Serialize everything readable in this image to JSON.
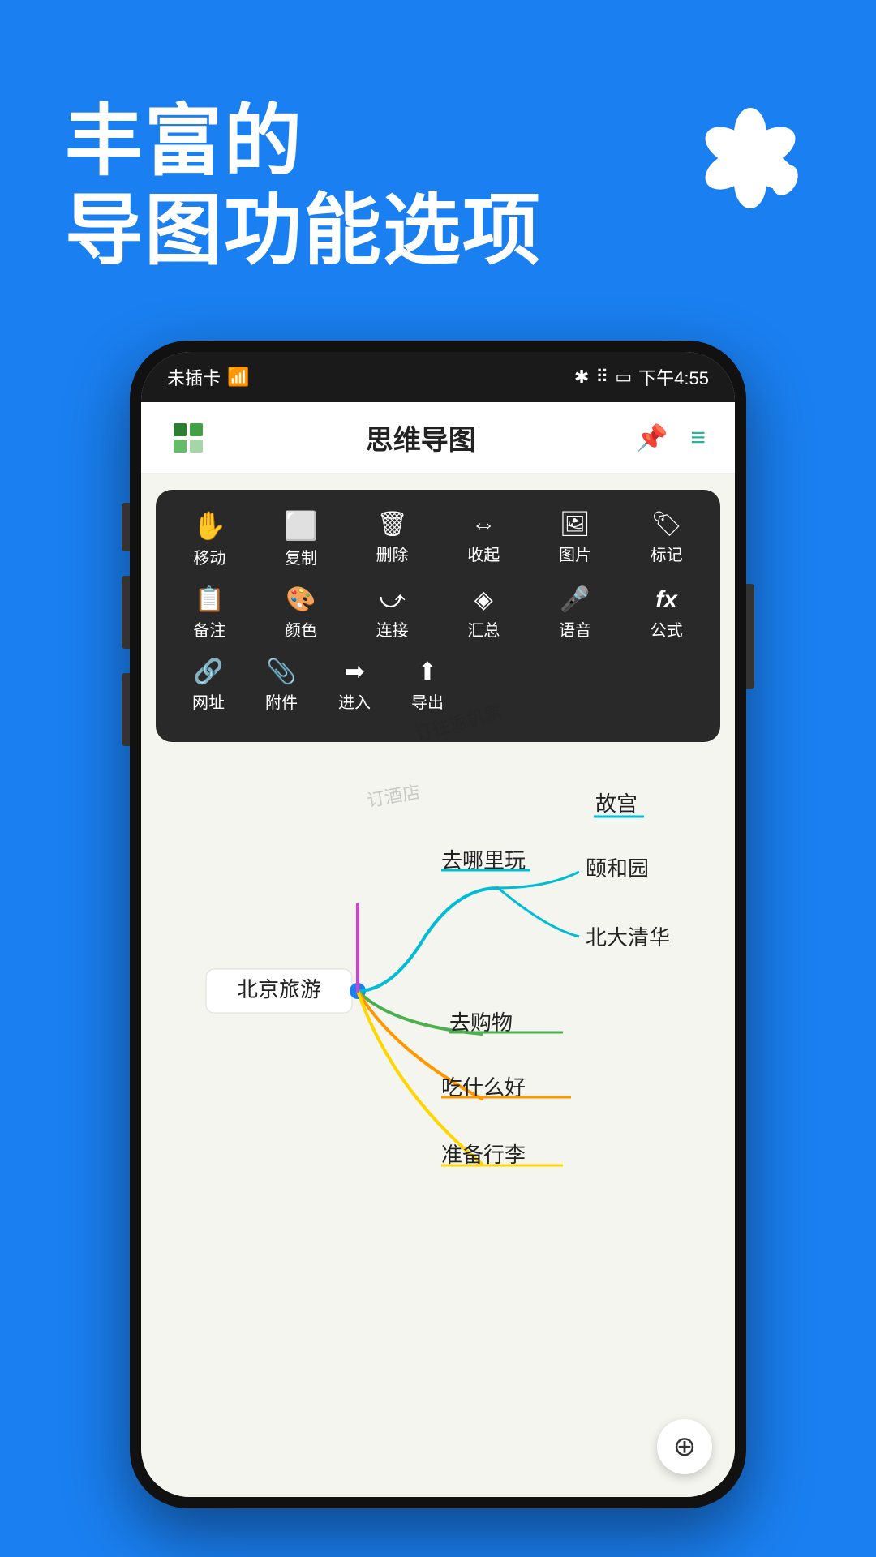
{
  "page": {
    "background_color": "#1a7ff0",
    "header_line1": "丰富的",
    "header_line2": "导图功能选项",
    "logo_alt": "flower-logo"
  },
  "status_bar": {
    "left": "未插卡🔋 📶",
    "left_text": "未插卡",
    "wifi": "WiFi",
    "bluetooth": "✱",
    "vibrate": "📳",
    "battery": "🔋",
    "time": "下午4:55"
  },
  "app_bar": {
    "title": "思维导图",
    "icon_left_alt": "layers-icon",
    "icon_right1_alt": "pin-icon",
    "icon_right2_alt": "menu-icon"
  },
  "toolbar": {
    "rows": [
      [
        {
          "icon": "✋",
          "label": "移动"
        },
        {
          "icon": "⬜",
          "label": "复制"
        },
        {
          "icon": "🗑",
          "label": "删除"
        },
        {
          "icon": "⇱",
          "label": "收起"
        },
        {
          "icon": "🖼",
          "label": "图片"
        },
        {
          "icon": "🏷",
          "label": "标记"
        }
      ],
      [
        {
          "icon": "📋",
          "label": "备注"
        },
        {
          "icon": "🎨",
          "label": "颜色"
        },
        {
          "icon": "⤻",
          "label": "连接"
        },
        {
          "icon": "◈",
          "label": "汇总"
        },
        {
          "icon": "🎤",
          "label": "语音"
        },
        {
          "icon": "fx",
          "label": "公式"
        }
      ],
      [
        {
          "icon": "🔗",
          "label": "网址"
        },
        {
          "icon": "📎",
          "label": "附件"
        },
        {
          "icon": "➡",
          "label": "进入"
        },
        {
          "icon": "↑",
          "label": "导出"
        }
      ]
    ]
  },
  "mindmap": {
    "root_node": "北京旅游",
    "branches": [
      {
        "label": "去哪里玩",
        "color": "#00bcd4",
        "sub": [
          "颐和园",
          "北大清华"
        ]
      },
      {
        "label": "去购物",
        "color": "#4caf50"
      },
      {
        "label": "吃什么好",
        "color": "#ff9800"
      },
      {
        "label": "准备行李",
        "color": "#ffd600"
      }
    ],
    "watermarks": [
      "订往返机票",
      "订酒店"
    ],
    "故宫_label": "故宫"
  },
  "zoom_button": "⊕"
}
